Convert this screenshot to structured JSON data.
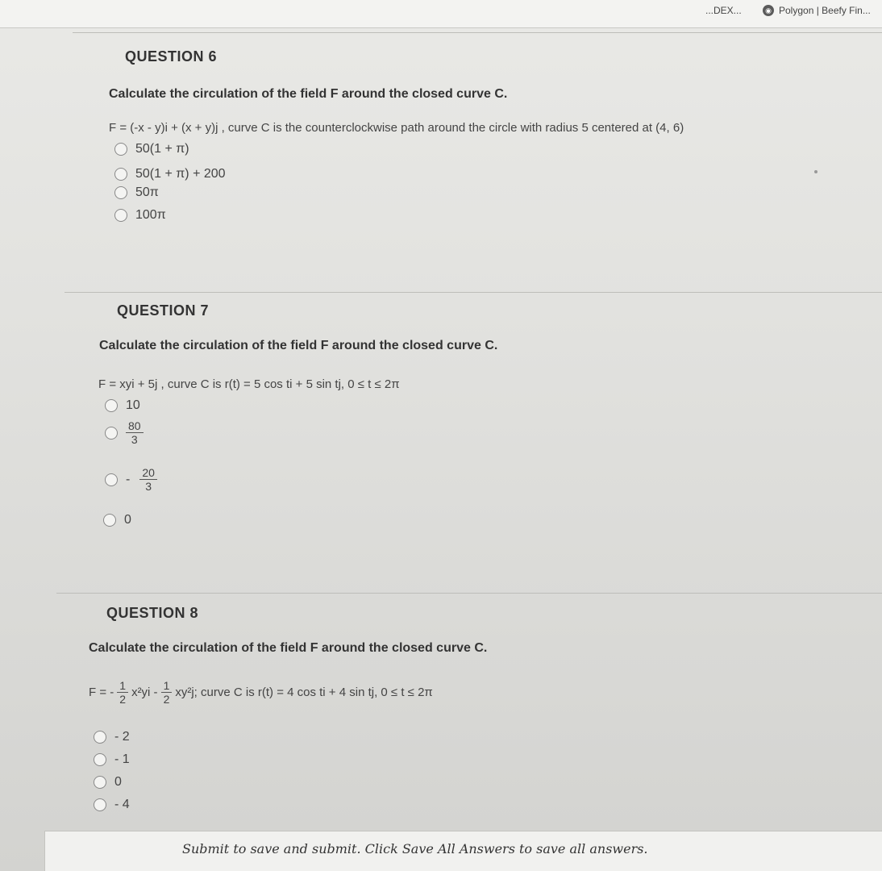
{
  "bookmarks": {
    "partial": "...DEX...",
    "polygon": "Polygon | Beefy Fin..."
  },
  "questions": [
    {
      "title": "QUESTION 6",
      "prompt": "Calculate the circulation of the field F around the closed curve C.",
      "expression": "F = (-x - y)i + (x + y)j , curve C is the counterclockwise path around the circle with radius 5 centered at (4, 6)",
      "options": [
        "50(1 + π)",
        "50(1 + π) + 200",
        "50π",
        "100π"
      ]
    },
    {
      "title": "QUESTION 7",
      "prompt": "Calculate the circulation of the field F around the closed curve C.",
      "expression": "F = xyi + 5j , curve C is r(t) = 5 cos ti + 5 sin tj, 0 ≤ t ≤ 2π",
      "options": [
        {
          "text": "10"
        },
        {
          "num": "80",
          "den": "3"
        },
        {
          "sign": "-",
          "num": "20",
          "den": "3"
        },
        {
          "text": "0"
        }
      ]
    },
    {
      "title": "QUESTION 8",
      "prompt": "Calculate the circulation of the field F around the closed curve C.",
      "expression": {
        "lead": "F = -",
        "frac1": {
          "num": "1",
          "den": "2"
        },
        "term1": "x²yi -",
        "frac2": {
          "num": "1",
          "den": "2"
        },
        "term2": "xy²j; curve C is r(t) = 4 cos ti + 4 sin tj, 0 ≤ t ≤ 2π"
      },
      "options": [
        "- 2",
        "- 1",
        "0",
        "- 4"
      ]
    }
  ],
  "footer": {
    "text": "Submit to save and submit. Click Save All Answers to save all answers."
  }
}
